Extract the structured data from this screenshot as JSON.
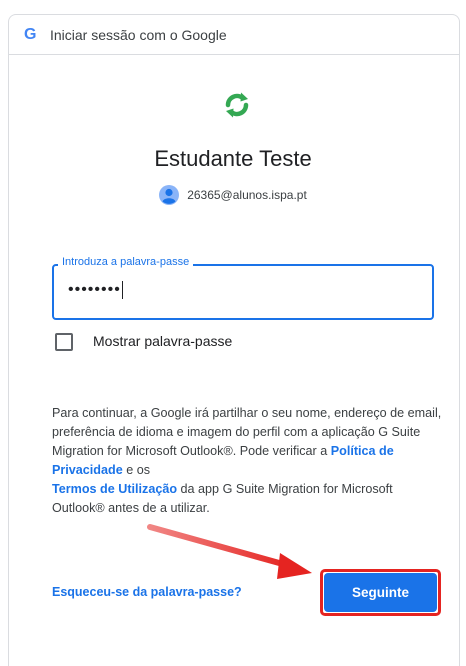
{
  "header": {
    "logo_letter": "G",
    "title": "Iniciar sessão com o Google"
  },
  "app": {
    "name": "Estudante Teste",
    "icon": "sync-arrows-icon"
  },
  "account": {
    "email": "26365@alunos.ispa.pt",
    "avatar": "avatar-icon"
  },
  "password": {
    "label": "Introduza a palavra-passe",
    "value": "••••••••"
  },
  "show_password": {
    "label": "Mostrar palavra-passe",
    "checked": false
  },
  "consent": {
    "part1": "Para continuar, a Google irá partilhar o seu nome, endereço de email, preferência de idioma e imagem do perfil com a aplicação G Suite Migration for Microsoft Outlook®. Pode verificar a ",
    "privacy_link": "Política de Privacidade",
    "part2": " e os",
    "terms_link": "Termos de Utilização",
    "part3": " da app G Suite Migration for Microsoft Outlook® antes de a utilizar."
  },
  "actions": {
    "forgot": "Esqueceu-se da palavra-passe?",
    "next": "Seguinte"
  },
  "colors": {
    "accent": "#1a73e8",
    "highlight": "#e52421",
    "icon_green": "#34a853"
  }
}
